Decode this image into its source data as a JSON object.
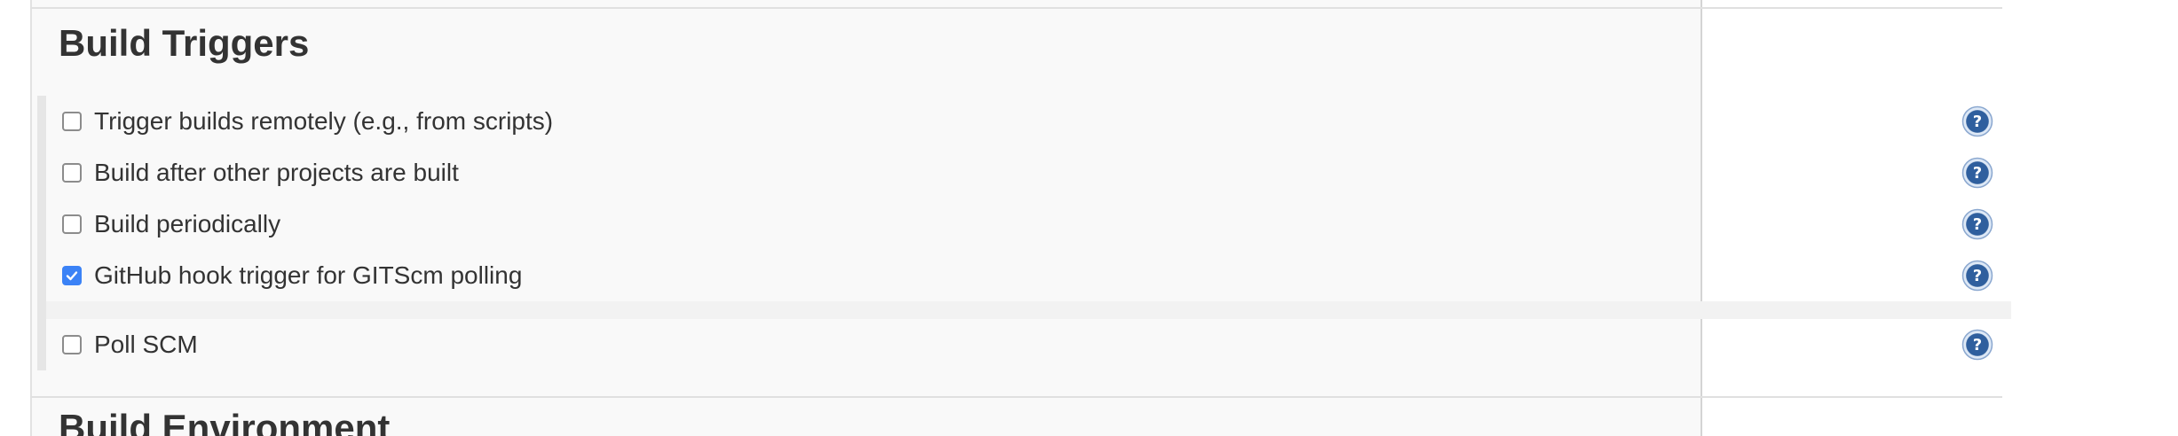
{
  "section": {
    "build_triggers_title": "Build Triggers",
    "build_environment_title": "Build Environment"
  },
  "triggers": [
    {
      "label": "Trigger builds remotely (e.g., from scripts)",
      "checked": false
    },
    {
      "label": "Build after other projects are built",
      "checked": false
    },
    {
      "label": "Build periodically",
      "checked": false
    },
    {
      "label": "GitHub hook trigger for GITScm polling",
      "checked": true
    },
    {
      "label": "Poll SCM",
      "checked": false
    }
  ],
  "icons": {
    "help": "help-icon",
    "check": "checkmark-icon"
  },
  "colors": {
    "checkbox_checked": "#3b82f6",
    "help_icon": "#2f5f9e",
    "text": "#333333",
    "panel_bg": "#f9f9f9"
  }
}
